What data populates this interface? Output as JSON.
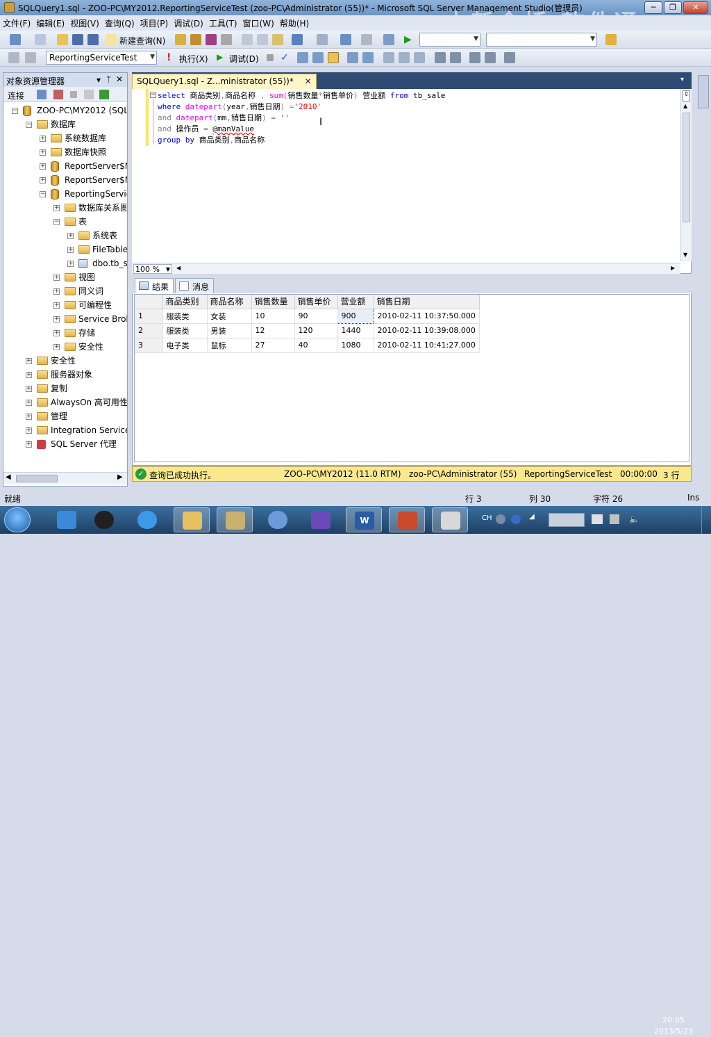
{
  "window": {
    "title": "SQLQuery1.sql - ZOO-PC\\MY2012.ReportingServiceTest (zoo-PC\\Administrator (55))* - Microsoft SQL Server Management Studio(管理员)",
    "watermark": "中新金桥 软件通"
  },
  "menu": [
    "文件(F)",
    "编辑(E)",
    "视图(V)",
    "查询(Q)",
    "项目(P)",
    "调试(D)",
    "工具(T)",
    "窗口(W)",
    "帮助(H)"
  ],
  "toolbar1": {
    "new_query": "新建查询(N)"
  },
  "toolbar2": {
    "database": "ReportingServiceTest",
    "execute": "执行(X)",
    "debug": "调试(D)"
  },
  "object_explorer": {
    "title": "对象资源管理器",
    "connect": "连接",
    "nodes": [
      {
        "label": "ZOO-PC\\MY2012 (SQL",
        "level": 0,
        "icon": "server-icon",
        "state": "expanded"
      },
      {
        "label": "数据库",
        "level": 1,
        "icon": "folder-icon",
        "state": "expanded"
      },
      {
        "label": "系统数据库",
        "level": 2,
        "icon": "folder-icon",
        "state": "collapsed"
      },
      {
        "label": "数据库快照",
        "level": 2,
        "icon": "folder-icon",
        "state": "collapsed"
      },
      {
        "label": "ReportServer$M",
        "level": 2,
        "icon": "database-icon",
        "state": "collapsed"
      },
      {
        "label": "ReportServer$M",
        "level": 2,
        "icon": "database-icon",
        "state": "collapsed"
      },
      {
        "label": "ReportingServic",
        "level": 2,
        "icon": "database-icon",
        "state": "expanded"
      },
      {
        "label": "数据库关系图",
        "level": 3,
        "icon": "folder-icon",
        "state": "collapsed"
      },
      {
        "label": "表",
        "level": 3,
        "icon": "folder-icon",
        "state": "expanded"
      },
      {
        "label": "系统表",
        "level": 4,
        "icon": "folder-icon",
        "state": "collapsed"
      },
      {
        "label": "FileTables",
        "level": 4,
        "icon": "folder-icon",
        "state": "collapsed"
      },
      {
        "label": "dbo.tb_sa",
        "level": 4,
        "icon": "table-icon",
        "state": "collapsed"
      },
      {
        "label": "视图",
        "level": 3,
        "icon": "folder-icon",
        "state": "collapsed"
      },
      {
        "label": "同义词",
        "level": 3,
        "icon": "folder-icon",
        "state": "collapsed"
      },
      {
        "label": "可编程性",
        "level": 3,
        "icon": "folder-icon",
        "state": "collapsed"
      },
      {
        "label": "Service Brok",
        "level": 3,
        "icon": "folder-icon",
        "state": "collapsed"
      },
      {
        "label": "存储",
        "level": 3,
        "icon": "folder-icon",
        "state": "collapsed"
      },
      {
        "label": "安全性",
        "level": 3,
        "icon": "folder-icon",
        "state": "collapsed"
      },
      {
        "label": "安全性",
        "level": 1,
        "icon": "folder-icon",
        "state": "collapsed"
      },
      {
        "label": "服务器对象",
        "level": 1,
        "icon": "folder-icon",
        "state": "collapsed"
      },
      {
        "label": "复制",
        "level": 1,
        "icon": "folder-icon",
        "state": "collapsed"
      },
      {
        "label": "AlwaysOn 高可用性",
        "level": 1,
        "icon": "folder-icon",
        "state": "collapsed"
      },
      {
        "label": "管理",
        "level": 1,
        "icon": "folder-icon",
        "state": "collapsed"
      },
      {
        "label": "Integration Services",
        "level": 1,
        "icon": "folder-icon",
        "state": "collapsed"
      },
      {
        "label": "SQL Server 代理",
        "level": 1,
        "icon": "agent-icon",
        "state": "collapsed"
      }
    ]
  },
  "editor": {
    "tab_label": "SQLQuery1.sql - Z...ministrator (55))*",
    "zoom": "100 %",
    "code": [
      [
        {
          "t": "select ",
          "c": "kw"
        },
        {
          "t": "商品类别",
          "c": ""
        },
        {
          "t": ",",
          "c": "gr"
        },
        {
          "t": "商品名称 ",
          "c": ""
        },
        {
          "t": ", ",
          "c": "gr"
        },
        {
          "t": "sum",
          "c": "fn"
        },
        {
          "t": "(",
          "c": "gr"
        },
        {
          "t": "销售数量",
          "c": ""
        },
        {
          "t": "*",
          "c": "gr"
        },
        {
          "t": "销售单价",
          "c": ""
        },
        {
          "t": ") ",
          "c": "gr"
        },
        {
          "t": "营业额 ",
          "c": ""
        },
        {
          "t": "from ",
          "c": "kw"
        },
        {
          "t": "tb_sale",
          "c": ""
        }
      ],
      [
        {
          "t": "where ",
          "c": "kw"
        },
        {
          "t": "datepart",
          "c": "fn"
        },
        {
          "t": "(",
          "c": "gr"
        },
        {
          "t": "year",
          "c": ""
        },
        {
          "t": ",",
          "c": "gr"
        },
        {
          "t": "销售日期",
          "c": ""
        },
        {
          "t": ") ",
          "c": "gr"
        },
        {
          "t": "=",
          "c": "gr"
        },
        {
          "t": "'2010'",
          "c": "str"
        }
      ],
      [
        {
          "t": "and ",
          "c": "gr"
        },
        {
          "t": "datepart",
          "c": "fn"
        },
        {
          "t": "(",
          "c": "gr"
        },
        {
          "t": "mm",
          "c": ""
        },
        {
          "t": ",",
          "c": "gr"
        },
        {
          "t": "销售日期",
          "c": ""
        },
        {
          "t": ") ",
          "c": "gr"
        },
        {
          "t": "= ",
          "c": "gr"
        },
        {
          "t": "''",
          "c": "str"
        }
      ],
      [
        {
          "t": "and ",
          "c": "gr"
        },
        {
          "t": "操作员 ",
          "c": ""
        },
        {
          "t": "= ",
          "c": "gr"
        },
        {
          "t": "@manValue",
          "c": "var"
        }
      ],
      [
        {
          "t": "group by ",
          "c": "kw"
        },
        {
          "t": "商品类别",
          "c": ""
        },
        {
          "t": ",",
          "c": "gr"
        },
        {
          "t": "商品名称",
          "c": ""
        }
      ]
    ]
  },
  "results": {
    "tab_results": "结果",
    "tab_messages": "消息",
    "columns": [
      "商品类别",
      "商品名称",
      "销售数量",
      "销售单价",
      "营业额",
      "销售日期"
    ],
    "rows": [
      [
        "1",
        "服装类",
        "女装",
        "10",
        "90",
        "900",
        "2010-02-11 10:37:50.000"
      ],
      [
        "2",
        "服装类",
        "男装",
        "12",
        "120",
        "1440",
        "2010-02-11 10:39:08.000"
      ],
      [
        "3",
        "电子类",
        "鼠标",
        "27",
        "40",
        "1080",
        "2010-02-11 10:41:27.000"
      ]
    ]
  },
  "query_status": {
    "message": "查询已成功执行。",
    "server": "ZOO-PC\\MY2012 (11.0 RTM)",
    "user": "zoo-PC\\Administrator (55)",
    "database": "ReportingServiceTest",
    "elapsed": "00:00:00",
    "rows": "3 行"
  },
  "statusbar": {
    "ready": "就绪",
    "line": "行 3",
    "col": "列 30",
    "char": "字符 26",
    "mode": "Ins"
  },
  "taskbar": {
    "lang": "CH",
    "time": "20:05",
    "date": "2013/5/23"
  },
  "colors": {
    "title_bar": "#7aa0cc",
    "tab_active": "#fff5c8",
    "status_yellow": "#f9e88e",
    "taskbar": "#2a5580"
  }
}
